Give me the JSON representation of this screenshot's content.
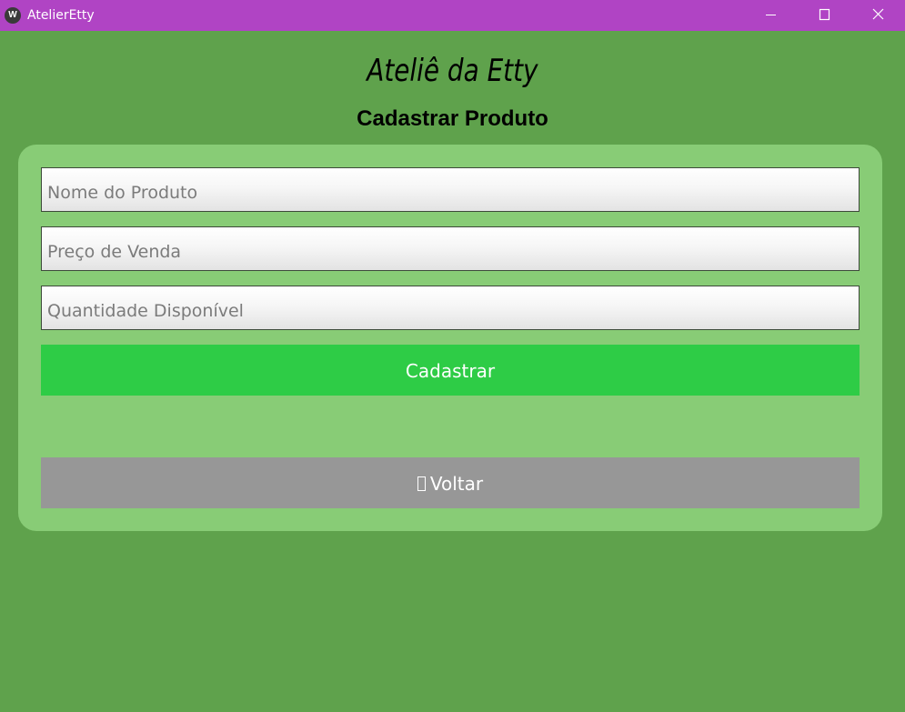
{
  "window": {
    "title": "AtelierEtty",
    "icon": "kivy-app-icon",
    "icon_glyph": "W",
    "titlebar_color": "#b044c4"
  },
  "header": {
    "app_name": "Ateliê da Etty",
    "page_title": "Cadastrar Produto"
  },
  "form": {
    "fields": {
      "nome": {
        "placeholder": "Nome do Produto",
        "value": ""
      },
      "preco": {
        "placeholder": "Preço de Venda",
        "value": ""
      },
      "quantidade": {
        "placeholder": "Quantidade Disponível",
        "value": ""
      }
    },
    "submit_label": "Cadastrar",
    "back_label": "Voltar",
    "back_icon": "missing-glyph-icon"
  },
  "colors": {
    "background": "#5fa24c",
    "card": "#88cc76",
    "submit_button": "#2ecc46",
    "back_button": "#979797"
  }
}
